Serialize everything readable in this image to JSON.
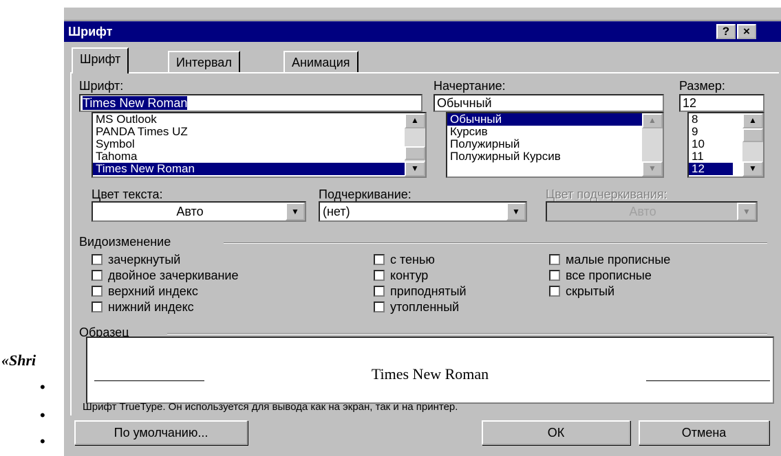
{
  "background_text": {
    "fragment": "«Shri",
    "bullet_glyph": "•"
  },
  "dialog": {
    "title": "Шрифт",
    "help_button": "?",
    "close_button": "×",
    "tabs": [
      "Шрифт",
      "Интервал",
      "Анимация"
    ],
    "font": {
      "label": "Шрифт:",
      "value": "Times New Roman",
      "items": [
        "MS Outlook",
        "PANDA Times UZ",
        "Symbol",
        "Tahoma",
        "Times New Roman"
      ],
      "selected_index": 4
    },
    "style": {
      "label": "Начертание:",
      "value": "Обычный",
      "items": [
        "Обычный",
        "Курсив",
        "Полужирный",
        "Полужирный Курсив"
      ],
      "selected_index": 0
    },
    "size": {
      "label": "Размер:",
      "value": "12",
      "items": [
        "8",
        "9",
        "10",
        "11",
        "12"
      ],
      "selected_index": 4
    },
    "text_color": {
      "label": "Цвет текста:",
      "value": "Авто"
    },
    "underline": {
      "label": "Подчеркивание:",
      "value": "(нет)"
    },
    "underline_color": {
      "label": "Цвет подчеркивания:",
      "value": "Авто"
    },
    "effects": {
      "group_label": "Видоизменение",
      "items": [
        {
          "label": "зачеркнутый",
          "checked": false
        },
        {
          "label": "двойное зачеркивание",
          "checked": false
        },
        {
          "label": "верхний индекс",
          "checked": false
        },
        {
          "label": "нижний индекс",
          "checked": false
        },
        {
          "label": "с тенью",
          "checked": false
        },
        {
          "label": "контур",
          "checked": false
        },
        {
          "label": "приподнятый",
          "checked": false
        },
        {
          "label": "утопленный",
          "checked": false
        },
        {
          "label": "малые прописные",
          "checked": false
        },
        {
          "label": "все прописные",
          "checked": false
        },
        {
          "label": "скрытый",
          "checked": false
        }
      ]
    },
    "sample": {
      "group_label": "Образец",
      "text": "Times New Roman",
      "note": "Шрифт TrueType. Он используется для вывода как на экран, так и на принтер."
    },
    "buttons": {
      "default": "По умолчанию...",
      "ok": "ОК",
      "cancel": "Отмена"
    },
    "colors": {
      "titlebar": "#000080",
      "face": "#c0c0c0",
      "selection": "#000080"
    }
  }
}
